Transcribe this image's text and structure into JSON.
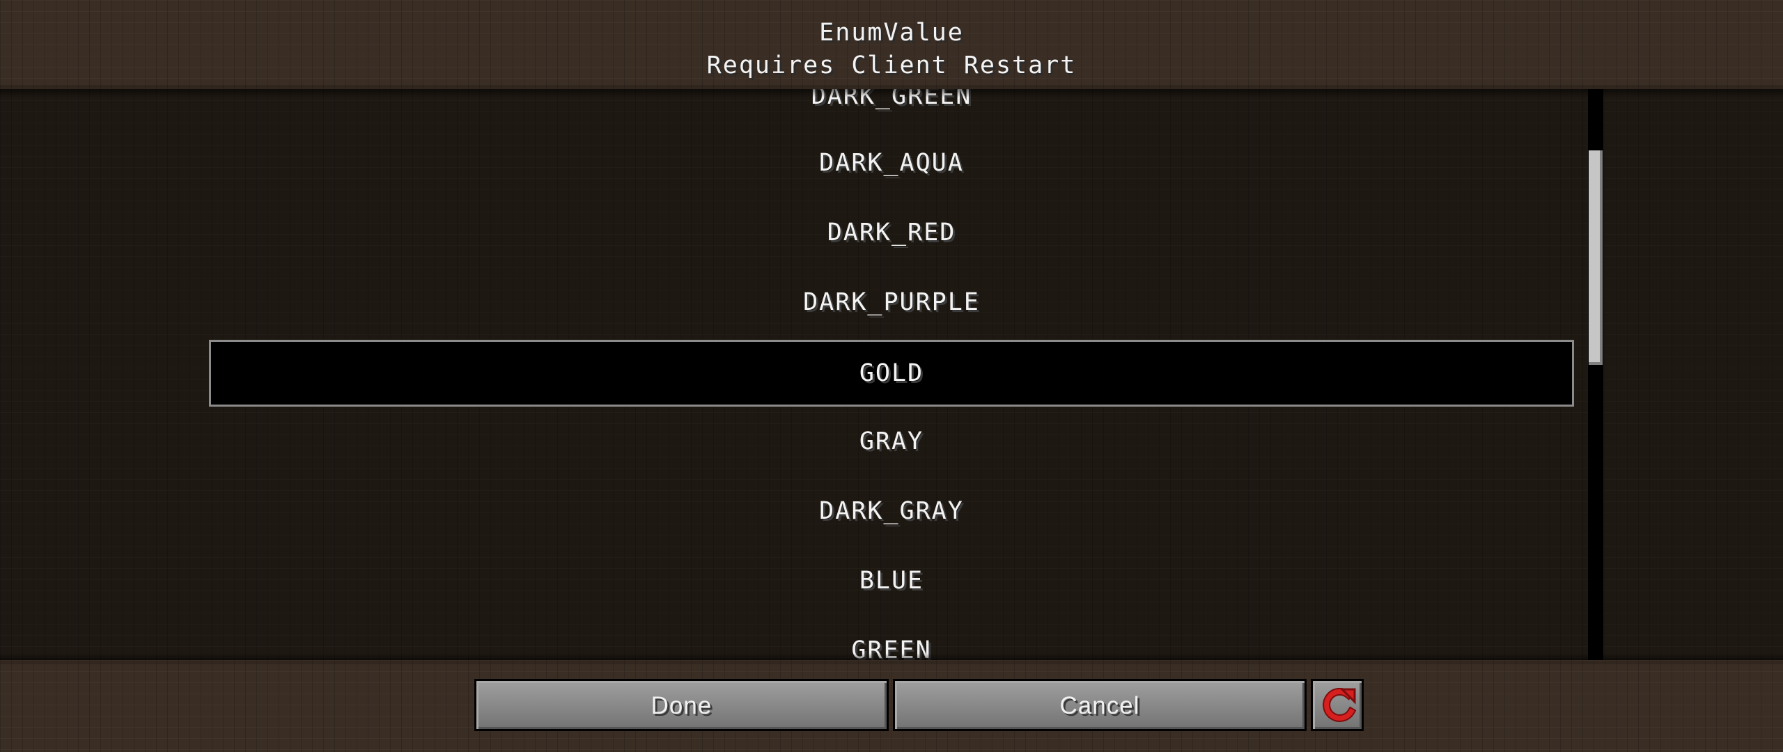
{
  "header": {
    "title": "EnumValue",
    "subtitle": "Requires Client Restart"
  },
  "list": {
    "items": [
      "DARK_GREEN",
      "DARK_AQUA",
      "DARK_RED",
      "DARK_PURPLE",
      "GOLD",
      "GRAY",
      "DARK_GRAY",
      "BLUE",
      "GREEN"
    ],
    "selected": "GOLD",
    "scroll_position": 0.18
  },
  "buttons": {
    "done_label": "Done",
    "cancel_label": "Cancel",
    "reset_icon": "reset-icon"
  },
  "colors": {
    "selected_background": "#000000",
    "selected_border": "#8b8b8b",
    "reset_icon": "#c41919"
  }
}
